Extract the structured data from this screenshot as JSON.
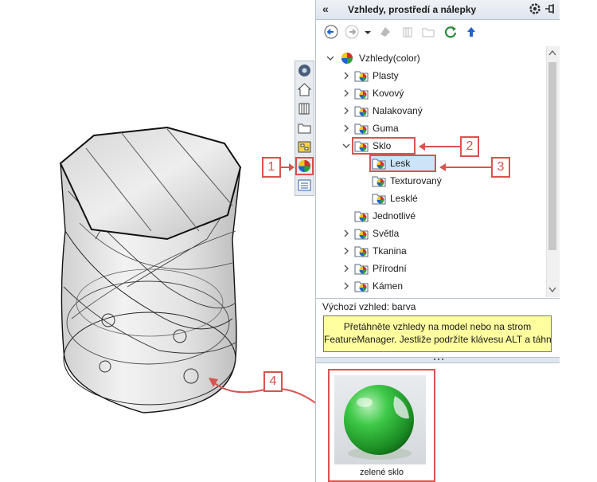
{
  "pane": {
    "title": "Vzhledy, prostředí a nálepky",
    "collapse_glyph": "«"
  },
  "toolbar": {
    "icons": [
      "back-icon",
      "forward-icon",
      "dropdown-icon",
      "appearance-icon",
      "scene-icon",
      "folder-icon",
      "refresh-icon",
      "up-icon"
    ]
  },
  "tree": {
    "root": "Vzhledy(color)",
    "items": [
      {
        "label": "Plasty"
      },
      {
        "label": "Kovový"
      },
      {
        "label": "Nalakovaný"
      },
      {
        "label": "Guma"
      },
      {
        "label": "Sklo"
      },
      {
        "label": "Lesk"
      },
      {
        "label": "Texturovaný"
      },
      {
        "label": "Lesklé"
      },
      {
        "label": "Jednotlivé"
      },
      {
        "label": "Světla"
      },
      {
        "label": "Tkanina"
      },
      {
        "label": "Přírodní"
      },
      {
        "label": "Kámen"
      }
    ]
  },
  "status": "Výchozí vzhled: barva",
  "tooltip": {
    "line1": "Přetáhněte vzhledy na model nebo na strom",
    "line2": "FeatureManager. Jestliže podržíte klávesu ALT a táhn..."
  },
  "preview": {
    "caption": "zelené sklo"
  },
  "callouts": [
    "1",
    "2",
    "3",
    "4"
  ],
  "colors": {
    "callout": "#d9534f",
    "tooltip_bg": "#ffffa0",
    "selection": "#cce4f7",
    "glass_green": "#22a52a"
  }
}
